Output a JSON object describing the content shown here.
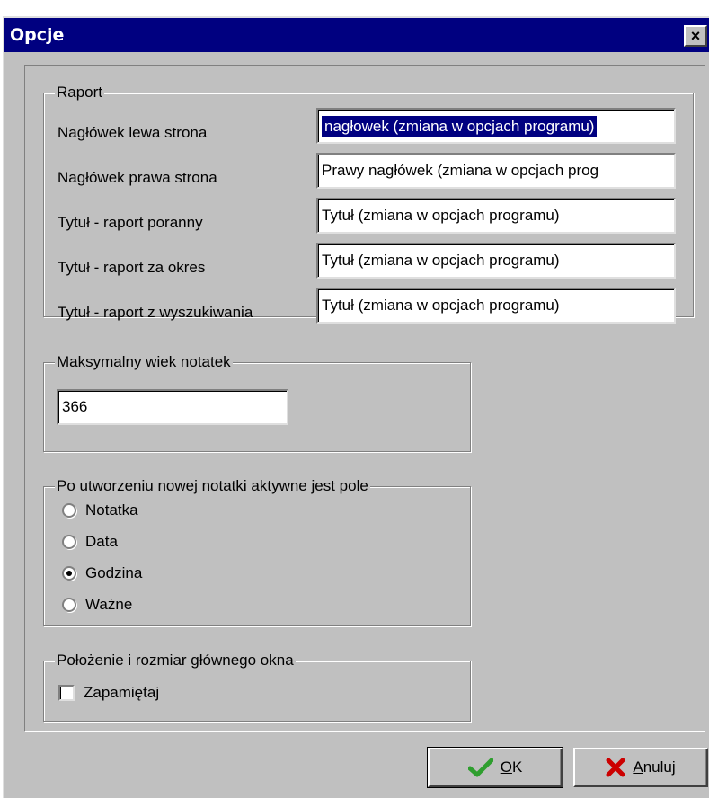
{
  "window": {
    "title": "Opcje",
    "close_glyph": "×"
  },
  "raport": {
    "legend": "Raport",
    "rows": [
      {
        "label": "Nagłówek lewa strona",
        "value": "nagłowek (zmiana w opcjach programu)"
      },
      {
        "label": "Nagłówek prawa strona",
        "value": "Prawy nagłówek (zmiana w opcjach prog"
      },
      {
        "label": "Tytuł - raport poranny",
        "value": "Tytuł (zmiana w opcjach programu)"
      },
      {
        "label": "Tytuł - raport za okres",
        "value": "Tytuł (zmiana w opcjach programu)"
      },
      {
        "label": "Tytuł - raport z wyszukiwania",
        "value": "Tytuł (zmiana w opcjach programu)"
      }
    ]
  },
  "max_age": {
    "legend": "Maksymalny wiek notatek",
    "value": "366"
  },
  "active_field": {
    "legend": "Po utworzeniu nowej notatki aktywne jest pole",
    "options": [
      "Notatka",
      "Data",
      "Godzina",
      "Ważne"
    ],
    "selected": "Godzina"
  },
  "window_pos": {
    "legend": "Położenie i rozmiar głównego okna",
    "checkbox_label": "Zapamiętaj",
    "checked": false
  },
  "buttons": {
    "ok": {
      "mnemonic": "O",
      "rest": "K",
      "icon": "check-icon"
    },
    "cancel": {
      "mnemonic": "A",
      "rest": "nuluj",
      "icon": "x-icon"
    }
  },
  "colors": {
    "titlebar": "#000080",
    "face": "#c0c0c0",
    "ok_icon": "#2e9e2e",
    "cancel_icon": "#cc0000"
  }
}
